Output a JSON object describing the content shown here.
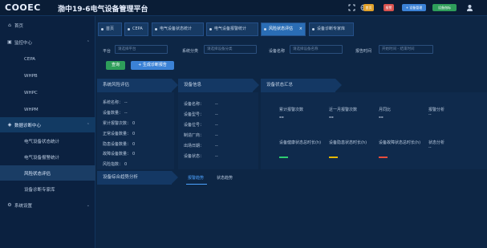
{
  "header": {
    "logo": "COOEC",
    "title": "渤中19-6电气设备管理平台",
    "icons": [
      "expand-icon",
      "globe-icon",
      "download-icon"
    ],
    "chips": [
      {
        "label": "首页",
        "color": "#e0a02a"
      },
      {
        "label": "报警",
        "color": "#d9534f"
      },
      {
        "label": "+ 设备管理",
        "color": "#3b82d6"
      },
      {
        "label": "设备指标",
        "color": "#2e9e5a"
      }
    ]
  },
  "sidebar": {
    "items": [
      {
        "label": "首页",
        "icon": "home-icon"
      },
      {
        "label": "监控中心",
        "icon": "monitor-icon"
      },
      {
        "label": "CEPA"
      },
      {
        "label": "WHPB"
      },
      {
        "label": "WHPC"
      },
      {
        "label": "WHPM"
      },
      {
        "label": "数据诊断中心",
        "icon": "diagnosis-icon"
      },
      {
        "label": "电气设备状态统计"
      },
      {
        "label": "电气设备报警统计"
      },
      {
        "label": "风险状态评估"
      },
      {
        "label": "设备诊断专家库"
      },
      {
        "label": "系统设置",
        "icon": "settings-icon"
      }
    ]
  },
  "tabs": [
    {
      "label": "首页"
    },
    {
      "label": "CEPA"
    },
    {
      "label": "电气设备状态统计"
    },
    {
      "label": "电气设备报警统计"
    },
    {
      "label": "风险状态评估",
      "close": "×"
    },
    {
      "label": "设备诊断专家库"
    }
  ],
  "filters": {
    "platform_label": "平台",
    "platform_placeholder": "请选择平台",
    "category_label": "系统分类",
    "category_placeholder": "请选择设备分类",
    "device_label": "设备名称",
    "device_placeholder": "请选择设备名称",
    "time_label": "报告时间",
    "time_placeholder": "开始时间 - 结束时间",
    "query_button": "查询",
    "report_button": "+ 生成诊断报告"
  },
  "panels": {
    "risk": {
      "title": "系统风险评估",
      "rows": [
        {
          "k": "系统名称：",
          "v": "--"
        },
        {
          "k": "设备数量：",
          "v": "--"
        },
        {
          "k": "累计报警次数：",
          "v": "0"
        },
        {
          "k": "正常设备数量：",
          "v": "0"
        },
        {
          "k": "隐患设备数量：",
          "v": "0"
        },
        {
          "k": "故障设备数量：",
          "v": "0"
        },
        {
          "k": "风险指数：",
          "v": "0"
        }
      ]
    },
    "info": {
      "title": "设备信息",
      "rows": [
        {
          "k": "设备名称：",
          "v": "--"
        },
        {
          "k": "设备型号：",
          "v": "--"
        },
        {
          "k": "设备位号：",
          "v": "--"
        },
        {
          "k": "制造厂商：",
          "v": "--"
        },
        {
          "k": "出场日期：",
          "v": "--"
        },
        {
          "k": "设备状态：",
          "v": "--"
        }
      ]
    },
    "status": {
      "title": "设备状态汇总",
      "stats_row1": [
        {
          "label": "累计报警次数",
          "value": "--"
        },
        {
          "label": "近一月报警次数",
          "value": "--"
        },
        {
          "label": "月同比",
          "value": "--"
        },
        {
          "label": "报警分析",
          "value": "--"
        }
      ],
      "stats_row2": [
        {
          "label": "设备健康状态总时长(h)",
          "color": "#2ecc71"
        },
        {
          "label": "设备隐患状态时长(h)",
          "color": "#e6b800"
        },
        {
          "label": "设备故障状态总时长(h)",
          "color": "#e74c3c"
        },
        {
          "label": "状态分析",
          "value": "--"
        }
      ]
    },
    "analysis": {
      "title": "设备综合趋势分析",
      "tabs": [
        "报警趋势",
        "状态趋势"
      ]
    }
  }
}
